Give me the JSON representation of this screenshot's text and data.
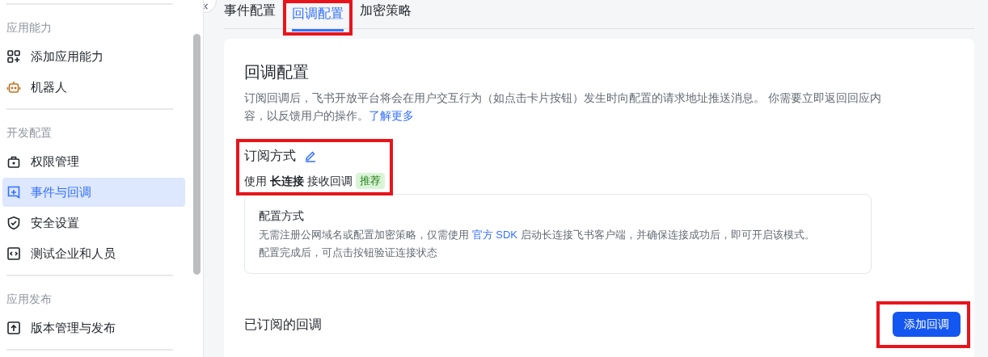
{
  "sidebar": {
    "groups": [
      {
        "title": "应用能力",
        "items": [
          {
            "label": "添加应用能力",
            "selected": false
          },
          {
            "label": "机器人",
            "selected": false
          }
        ]
      },
      {
        "title": "开发配置",
        "items": [
          {
            "label": "权限管理",
            "selected": false
          },
          {
            "label": "事件与回调",
            "selected": true
          },
          {
            "label": "安全设置",
            "selected": false
          },
          {
            "label": "测试企业和人员",
            "selected": false
          }
        ]
      },
      {
        "title": "应用发布",
        "items": [
          {
            "label": "版本管理与发布",
            "selected": false
          }
        ]
      }
    ]
  },
  "tabs": [
    {
      "label": "事件配置",
      "selected": false,
      "highlighted": false
    },
    {
      "label": "回调配置",
      "selected": true,
      "highlighted": true
    },
    {
      "label": "加密策略",
      "selected": false,
      "highlighted": false
    }
  ],
  "card": {
    "title": "回调配置",
    "description": "订阅回调后，飞书开放平台将会在用户交互行为（如点击卡片按钮）发生时向配置的请求地址推送消息。 你需要立即返回回应内容，以反馈用户的操作。",
    "link": "了解更多"
  },
  "subscription": {
    "title": "订阅方式",
    "highlighted": true,
    "mode": "使用 **长连接** 接收回调",
    "badge": "推荐"
  },
  "config_box": {
    "title": "配置方式",
    "text_before": "无需注册公网域名或配置加密策略，仅需使用",
    "link": "官方 SDK",
    "text_after": "启动长连接飞书客户端，并确保连接成功后，即可开启该模式。",
    "note": "配置完成后，可点击按钮验证连接状态"
  },
  "subscribed": {
    "title": "已订阅的回调",
    "button": "添加回调",
    "button_highlighted": true
  }
}
